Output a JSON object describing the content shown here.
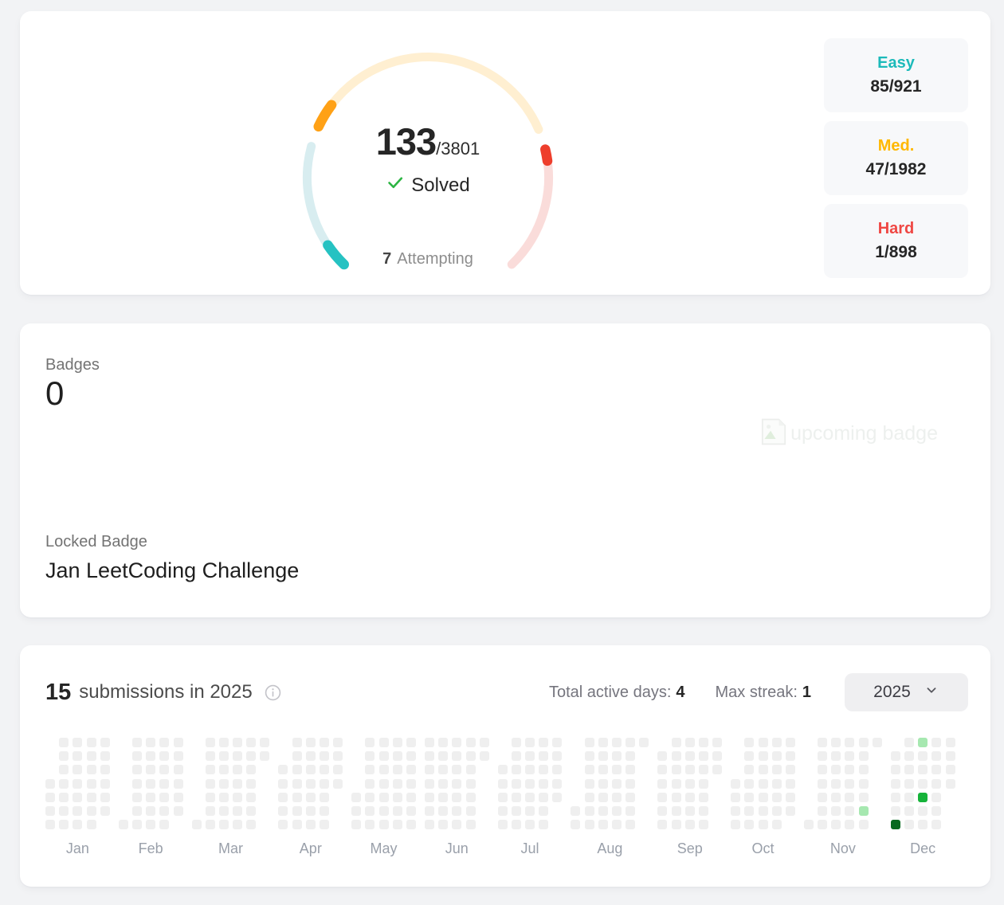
{
  "solve_card": {
    "solved": "133",
    "total_suffix": "/3801",
    "solved_label": "Solved",
    "attempting_count": "7",
    "attempting_label": "Attempting",
    "difficulties": [
      {
        "label": "Easy",
        "value": "85/921",
        "color": "#1cbaba"
      },
      {
        "label": "Med.",
        "value": "47/1982",
        "color": "#ffb800"
      },
      {
        "label": "Hard",
        "value": "1/898",
        "color": "#ef4743"
      }
    ]
  },
  "badges_card": {
    "title": "Badges",
    "count": "0",
    "upcoming_badge_text": "upcoming badge",
    "locked_label": "Locked Badge",
    "locked_badge_name": "Jan LeetCoding Challenge"
  },
  "submissions_card": {
    "count": "15",
    "count_suffix": "submissions in 2025",
    "total_active_days_label": "Total active days:",
    "total_active_days_value": "4",
    "max_streak_label": "Max streak:",
    "max_streak_value": "1",
    "year_selector": "2025"
  },
  "chart_data": [
    {
      "type": "donut-gauge",
      "title": "Solved problems ring",
      "center_text": "133/3801 Solved, 7 Attempting",
      "segments": [
        {
          "name": "Easy",
          "solved": 85,
          "total": 921,
          "color": "#26c2c2",
          "track_color": "#d8edf0"
        },
        {
          "name": "Medium",
          "solved": 47,
          "total": 1982,
          "color": "#ffa116",
          "track_color": "#ffefd1"
        },
        {
          "name": "Hard",
          "solved": 1,
          "total": 898,
          "color": "#ee3e2c",
          "track_color": "#fadcda"
        }
      ],
      "check_color": "#2cb543"
    },
    {
      "type": "heatmap",
      "title": "Submission calendar",
      "year": 2025,
      "month_labels": [
        "Jan",
        "Feb",
        "Mar",
        "Apr",
        "May",
        "Jun",
        "Jul",
        "Aug",
        "Sep",
        "Oct",
        "Nov",
        "Dec"
      ],
      "active_days": {
        "2025-11-28": 1,
        "2025-12-06": 3,
        "2025-12-14": 1,
        "2025-12-18": 2
      },
      "level_colors": {
        "1": "#a6e8b0",
        "2": "#16b33a",
        "3": "#07691f"
      },
      "empty_color": "#efefef"
    }
  ]
}
